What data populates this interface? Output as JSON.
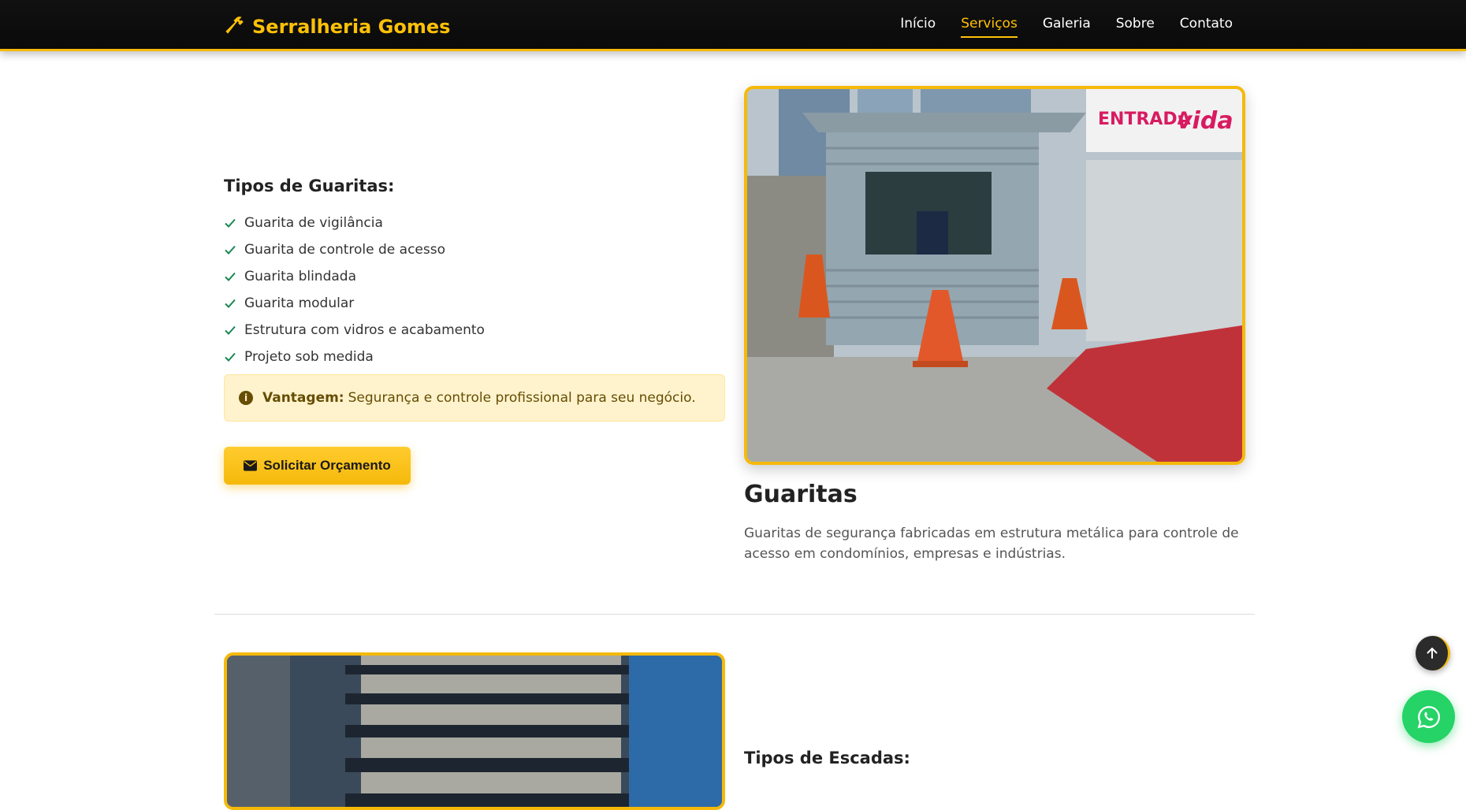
{
  "brand": {
    "name": "Serralheria Gomes",
    "icon": "hammer-icon",
    "color": "#ffc107"
  },
  "nav": {
    "items": [
      {
        "label": "Início",
        "active": false
      },
      {
        "label": "Serviços",
        "active": true
      },
      {
        "label": "Galeria",
        "active": false
      },
      {
        "label": "Sobre",
        "active": false
      },
      {
        "label": "Contato",
        "active": false
      }
    ]
  },
  "service": {
    "features_title": "Tipos de Guaritas:",
    "features": [
      "Guarita de vigilância",
      "Guarita de controle de acesso",
      "Guarita blindada",
      "Guarita modular",
      "Estrutura com vidros e acabamento",
      "Projeto sob medida"
    ],
    "advantage_label": "Vantagem:",
    "advantage_text": "Segurança e controle profissional para seu negócio.",
    "cta_label": "Solicitar Orçamento",
    "title": "Guaritas",
    "description": "Guaritas de segurança fabricadas em estrutura metálica para controle de acesso em condomínios, empresas e indústrias."
  },
  "next_service": {
    "features_title": "Tipos de Escadas:"
  },
  "floating": {
    "back_to_top_icon": "arrow-up-icon",
    "whatsapp_icon": "whatsapp-icon"
  },
  "colors": {
    "accent": "#f5b90a",
    "check": "#198754",
    "whatsapp": "#25d366"
  }
}
